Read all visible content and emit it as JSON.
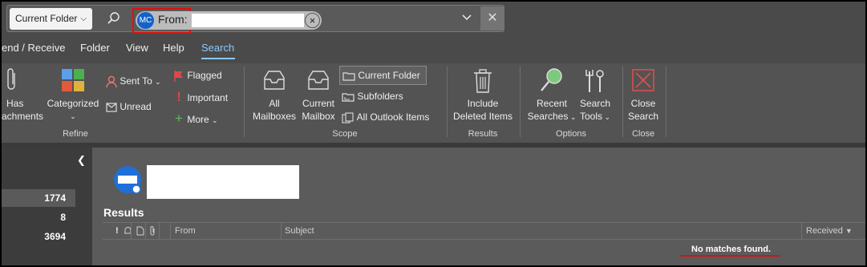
{
  "search_bar": {
    "scope_label": "Current Folder",
    "criteria": {
      "avatar_initials": "MC",
      "label": "From:"
    }
  },
  "menu_tabs": [
    "end / Receive",
    "Folder",
    "View",
    "Help",
    "Search"
  ],
  "active_tab": "Search",
  "ribbon": {
    "refine": {
      "group_label": "Refine",
      "has_attachments": [
        "Has",
        "achments"
      ],
      "categorized": "Categorized",
      "sent_to": "Sent To",
      "unread": "Unread",
      "flagged": "Flagged",
      "important": "Important",
      "more": "More"
    },
    "scope": {
      "group_label": "Scope",
      "all_mailboxes": [
        "All",
        "Mailboxes"
      ],
      "current_mailbox": [
        "Current",
        "Mailbox"
      ],
      "current_folder": "Current Folder",
      "subfolders": "Subfolders",
      "all_outlook_items": "All Outlook Items"
    },
    "results": {
      "group_label": "Results",
      "include_deleted": [
        "Include",
        "Deleted Items"
      ]
    },
    "options": {
      "group_label": "Options",
      "recent_searches": [
        "Recent",
        "Searches"
      ],
      "search_tools": [
        "Search",
        "Tools"
      ]
    },
    "close": {
      "group_label": "Close",
      "close_search": [
        "Close",
        "Search"
      ]
    }
  },
  "nav": {
    "counts": [
      "1774",
      "8",
      "3694"
    ]
  },
  "results": {
    "title": "Results",
    "columns": {
      "from": "From",
      "subject": "Subject",
      "received": "Received"
    },
    "empty_message": "No matches found."
  },
  "colors": {
    "accent": "#8cc7ff",
    "highlight": "#dd1111",
    "avatar": "#1462c8"
  }
}
